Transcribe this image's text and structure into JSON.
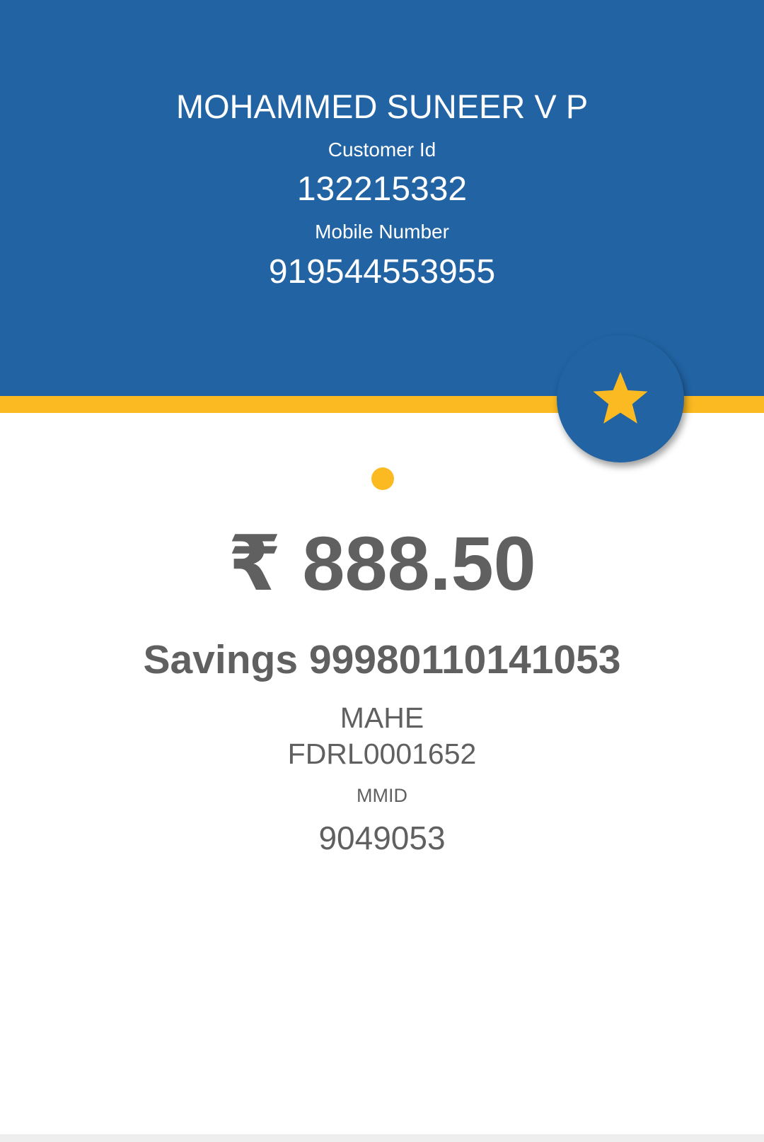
{
  "header": {
    "customer_name": "MOHAMMED SUNEER V P",
    "customer_id_label": "Customer Id",
    "customer_id": "132215332",
    "mobile_label": "Mobile Number",
    "mobile_number": "919544553955"
  },
  "favorite": {
    "icon": "star-icon"
  },
  "account": {
    "balance": "₹ 888.50",
    "account_label": "Savings 99980110141053",
    "branch": "MAHE",
    "ifsc": "FDRL0001652",
    "mmid_label": "MMID",
    "mmid": "9049053"
  },
  "colors": {
    "primary": "#2163a3",
    "accent": "#fbba22",
    "text": "#606060"
  }
}
